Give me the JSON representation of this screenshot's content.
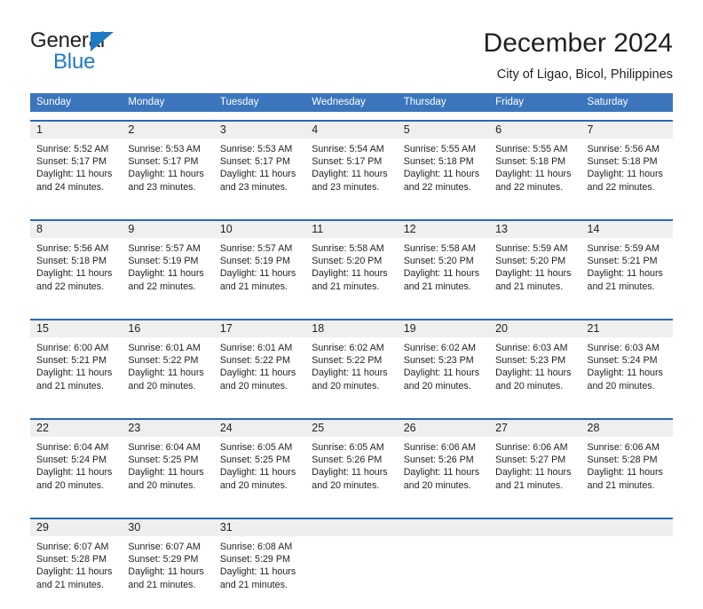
{
  "logo": {
    "word1": "General",
    "word2": "Blue",
    "triangle_color": "#1f7ac4"
  },
  "header": {
    "title": "December 2024",
    "subtitle": "City of Ligao, Bicol, Philippines"
  },
  "theme": {
    "header_blue": "#3b76bd",
    "rule_blue": "#2a6ab3",
    "daynum_band": "#efefef",
    "text": "#231f20"
  },
  "weekdays": [
    "Sunday",
    "Monday",
    "Tuesday",
    "Wednesday",
    "Thursday",
    "Friday",
    "Saturday"
  ],
  "labels": {
    "sunrise_prefix": "Sunrise: ",
    "sunset_prefix": "Sunset: ",
    "daylight_prefix": "Daylight: "
  },
  "weeks": [
    [
      {
        "day": "1",
        "sunrise": "Sunrise: 5:52 AM",
        "sunset": "Sunset: 5:17 PM",
        "daylight_l1": "Daylight: 11 hours",
        "daylight_l2": "and 24 minutes."
      },
      {
        "day": "2",
        "sunrise": "Sunrise: 5:53 AM",
        "sunset": "Sunset: 5:17 PM",
        "daylight_l1": "Daylight: 11 hours",
        "daylight_l2": "and 23 minutes."
      },
      {
        "day": "3",
        "sunrise": "Sunrise: 5:53 AM",
        "sunset": "Sunset: 5:17 PM",
        "daylight_l1": "Daylight: 11 hours",
        "daylight_l2": "and 23 minutes."
      },
      {
        "day": "4",
        "sunrise": "Sunrise: 5:54 AM",
        "sunset": "Sunset: 5:17 PM",
        "daylight_l1": "Daylight: 11 hours",
        "daylight_l2": "and 23 minutes."
      },
      {
        "day": "5",
        "sunrise": "Sunrise: 5:55 AM",
        "sunset": "Sunset: 5:18 PM",
        "daylight_l1": "Daylight: 11 hours",
        "daylight_l2": "and 22 minutes."
      },
      {
        "day": "6",
        "sunrise": "Sunrise: 5:55 AM",
        "sunset": "Sunset: 5:18 PM",
        "daylight_l1": "Daylight: 11 hours",
        "daylight_l2": "and 22 minutes."
      },
      {
        "day": "7",
        "sunrise": "Sunrise: 5:56 AM",
        "sunset": "Sunset: 5:18 PM",
        "daylight_l1": "Daylight: 11 hours",
        "daylight_l2": "and 22 minutes."
      }
    ],
    [
      {
        "day": "8",
        "sunrise": "Sunrise: 5:56 AM",
        "sunset": "Sunset: 5:18 PM",
        "daylight_l1": "Daylight: 11 hours",
        "daylight_l2": "and 22 minutes."
      },
      {
        "day": "9",
        "sunrise": "Sunrise: 5:57 AM",
        "sunset": "Sunset: 5:19 PM",
        "daylight_l1": "Daylight: 11 hours",
        "daylight_l2": "and 22 minutes."
      },
      {
        "day": "10",
        "sunrise": "Sunrise: 5:57 AM",
        "sunset": "Sunset: 5:19 PM",
        "daylight_l1": "Daylight: 11 hours",
        "daylight_l2": "and 21 minutes."
      },
      {
        "day": "11",
        "sunrise": "Sunrise: 5:58 AM",
        "sunset": "Sunset: 5:20 PM",
        "daylight_l1": "Daylight: 11 hours",
        "daylight_l2": "and 21 minutes."
      },
      {
        "day": "12",
        "sunrise": "Sunrise: 5:58 AM",
        "sunset": "Sunset: 5:20 PM",
        "daylight_l1": "Daylight: 11 hours",
        "daylight_l2": "and 21 minutes."
      },
      {
        "day": "13",
        "sunrise": "Sunrise: 5:59 AM",
        "sunset": "Sunset: 5:20 PM",
        "daylight_l1": "Daylight: 11 hours",
        "daylight_l2": "and 21 minutes."
      },
      {
        "day": "14",
        "sunrise": "Sunrise: 5:59 AM",
        "sunset": "Sunset: 5:21 PM",
        "daylight_l1": "Daylight: 11 hours",
        "daylight_l2": "and 21 minutes."
      }
    ],
    [
      {
        "day": "15",
        "sunrise": "Sunrise: 6:00 AM",
        "sunset": "Sunset: 5:21 PM",
        "daylight_l1": "Daylight: 11 hours",
        "daylight_l2": "and 21 minutes."
      },
      {
        "day": "16",
        "sunrise": "Sunrise: 6:01 AM",
        "sunset": "Sunset: 5:22 PM",
        "daylight_l1": "Daylight: 11 hours",
        "daylight_l2": "and 20 minutes."
      },
      {
        "day": "17",
        "sunrise": "Sunrise: 6:01 AM",
        "sunset": "Sunset: 5:22 PM",
        "daylight_l1": "Daylight: 11 hours",
        "daylight_l2": "and 20 minutes."
      },
      {
        "day": "18",
        "sunrise": "Sunrise: 6:02 AM",
        "sunset": "Sunset: 5:22 PM",
        "daylight_l1": "Daylight: 11 hours",
        "daylight_l2": "and 20 minutes."
      },
      {
        "day": "19",
        "sunrise": "Sunrise: 6:02 AM",
        "sunset": "Sunset: 5:23 PM",
        "daylight_l1": "Daylight: 11 hours",
        "daylight_l2": "and 20 minutes."
      },
      {
        "day": "20",
        "sunrise": "Sunrise: 6:03 AM",
        "sunset": "Sunset: 5:23 PM",
        "daylight_l1": "Daylight: 11 hours",
        "daylight_l2": "and 20 minutes."
      },
      {
        "day": "21",
        "sunrise": "Sunrise: 6:03 AM",
        "sunset": "Sunset: 5:24 PM",
        "daylight_l1": "Daylight: 11 hours",
        "daylight_l2": "and 20 minutes."
      }
    ],
    [
      {
        "day": "22",
        "sunrise": "Sunrise: 6:04 AM",
        "sunset": "Sunset: 5:24 PM",
        "daylight_l1": "Daylight: 11 hours",
        "daylight_l2": "and 20 minutes."
      },
      {
        "day": "23",
        "sunrise": "Sunrise: 6:04 AM",
        "sunset": "Sunset: 5:25 PM",
        "daylight_l1": "Daylight: 11 hours",
        "daylight_l2": "and 20 minutes."
      },
      {
        "day": "24",
        "sunrise": "Sunrise: 6:05 AM",
        "sunset": "Sunset: 5:25 PM",
        "daylight_l1": "Daylight: 11 hours",
        "daylight_l2": "and 20 minutes."
      },
      {
        "day": "25",
        "sunrise": "Sunrise: 6:05 AM",
        "sunset": "Sunset: 5:26 PM",
        "daylight_l1": "Daylight: 11 hours",
        "daylight_l2": "and 20 minutes."
      },
      {
        "day": "26",
        "sunrise": "Sunrise: 6:06 AM",
        "sunset": "Sunset: 5:26 PM",
        "daylight_l1": "Daylight: 11 hours",
        "daylight_l2": "and 20 minutes."
      },
      {
        "day": "27",
        "sunrise": "Sunrise: 6:06 AM",
        "sunset": "Sunset: 5:27 PM",
        "daylight_l1": "Daylight: 11 hours",
        "daylight_l2": "and 21 minutes."
      },
      {
        "day": "28",
        "sunrise": "Sunrise: 6:06 AM",
        "sunset": "Sunset: 5:28 PM",
        "daylight_l1": "Daylight: 11 hours",
        "daylight_l2": "and 21 minutes."
      }
    ],
    [
      {
        "day": "29",
        "sunrise": "Sunrise: 6:07 AM",
        "sunset": "Sunset: 5:28 PM",
        "daylight_l1": "Daylight: 11 hours",
        "daylight_l2": "and 21 minutes."
      },
      {
        "day": "30",
        "sunrise": "Sunrise: 6:07 AM",
        "sunset": "Sunset: 5:29 PM",
        "daylight_l1": "Daylight: 11 hours",
        "daylight_l2": "and 21 minutes."
      },
      {
        "day": "31",
        "sunrise": "Sunrise: 6:08 AM",
        "sunset": "Sunset: 5:29 PM",
        "daylight_l1": "Daylight: 11 hours",
        "daylight_l2": "and 21 minutes."
      },
      {
        "day": "",
        "sunrise": "",
        "sunset": "",
        "daylight_l1": "",
        "daylight_l2": ""
      },
      {
        "day": "",
        "sunrise": "",
        "sunset": "",
        "daylight_l1": "",
        "daylight_l2": ""
      },
      {
        "day": "",
        "sunrise": "",
        "sunset": "",
        "daylight_l1": "",
        "daylight_l2": ""
      },
      {
        "day": "",
        "sunrise": "",
        "sunset": "",
        "daylight_l1": "",
        "daylight_l2": ""
      }
    ]
  ]
}
